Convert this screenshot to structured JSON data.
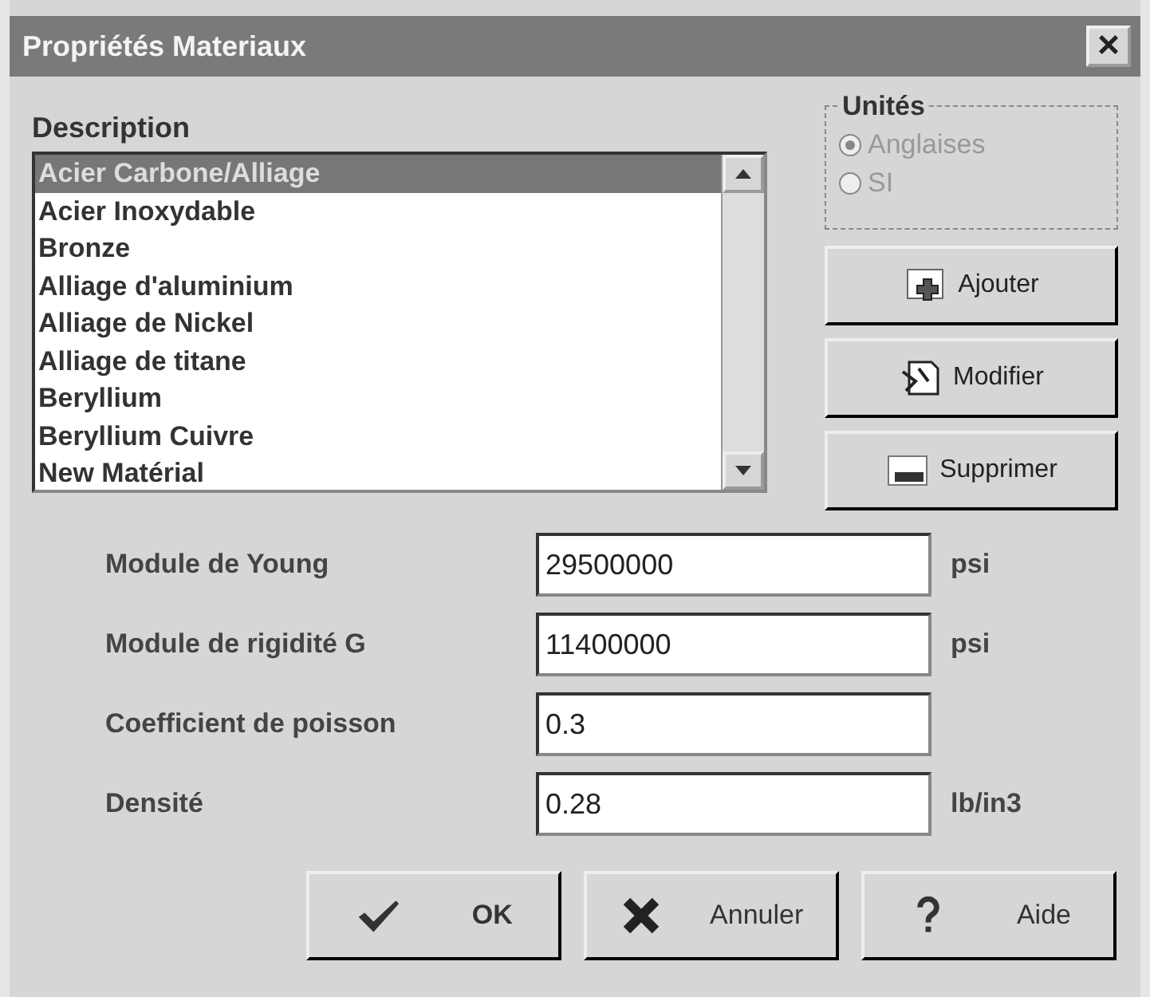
{
  "window": {
    "title": "Propriétés Materiaux",
    "close": "×"
  },
  "description": {
    "label": "Description",
    "items": [
      {
        "label": "Acier Carbone/Alliage",
        "selected": true
      },
      {
        "label": "Acier Inoxydable",
        "selected": false
      },
      {
        "label": "Bronze",
        "selected": false
      },
      {
        "label": "Alliage d'aluminium",
        "selected": false
      },
      {
        "label": "Alliage de Nickel",
        "selected": false
      },
      {
        "label": "Alliage de titane",
        "selected": false
      },
      {
        "label": "Beryllium",
        "selected": false
      },
      {
        "label": "Beryllium Cuivre",
        "selected": false
      },
      {
        "label": "New Matérial",
        "selected": false
      }
    ]
  },
  "units": {
    "label": "Unités",
    "disabled": true,
    "options": [
      {
        "label": "Anglaises",
        "selected": true
      },
      {
        "label": "SI",
        "selected": false
      }
    ]
  },
  "side_buttons": [
    {
      "label": "Ajouter",
      "kind": "add"
    },
    {
      "label": "Modifier",
      "kind": "edit"
    },
    {
      "label": "Supprimer",
      "kind": "delete"
    }
  ],
  "fields": [
    {
      "label": "Module de Young",
      "value": "29500000",
      "unit": "psi"
    },
    {
      "label": "Module de rigidité G",
      "value": "11400000",
      "unit": "psi"
    },
    {
      "label": "Coefficient de poisson",
      "value": "0.3"
    },
    {
      "label": "Densité",
      "value": "0.28",
      "unit": "lb/in3"
    }
  ],
  "buttons": [
    {
      "label": "OK",
      "kind": "ok"
    },
    {
      "label": "Annuler",
      "kind": "cancel"
    },
    {
      "label": "Aide",
      "kind": "help"
    }
  ]
}
